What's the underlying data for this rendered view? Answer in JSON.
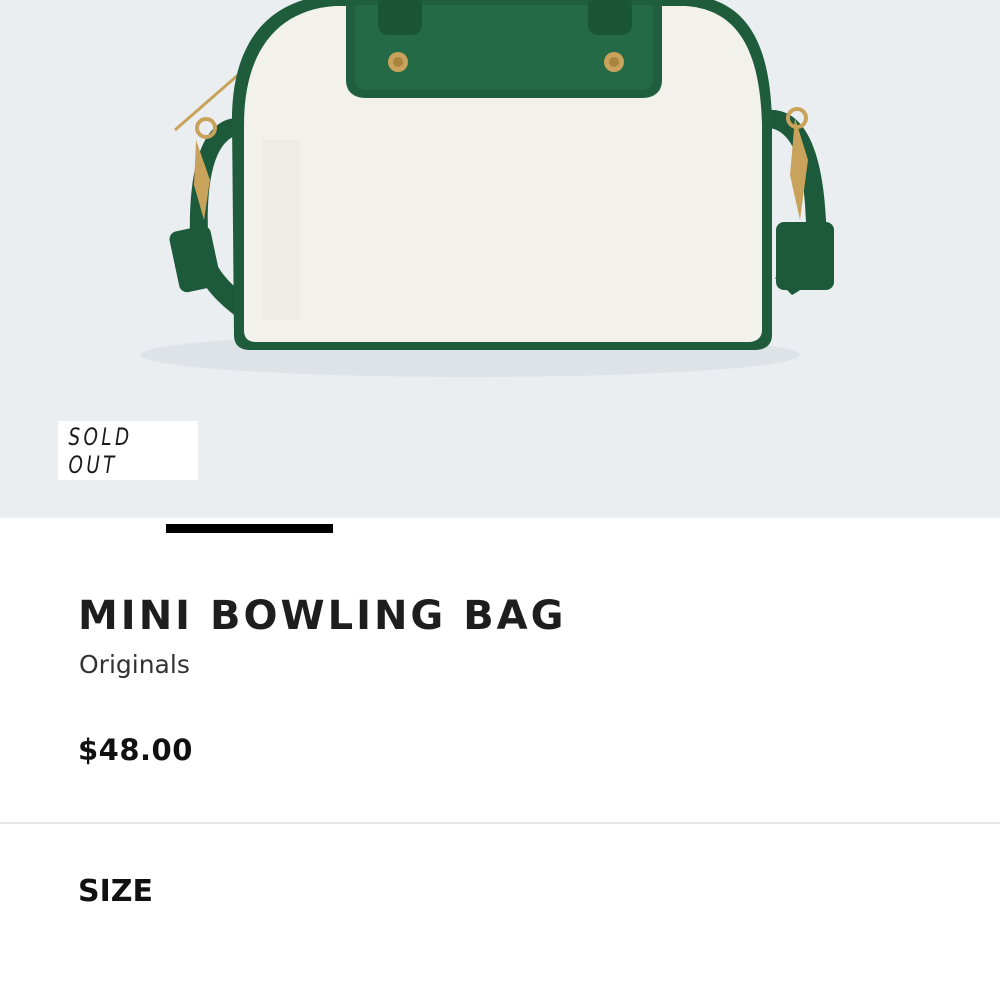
{
  "product": {
    "badge": "SOLD OUT",
    "name": "MINI BOWLING BAG",
    "category": "Originals",
    "price": "$48.00",
    "image_alt": "white and green bowling bag product photo"
  },
  "sections": {
    "size_heading": "SIZE"
  },
  "carousel": {
    "active_index": 2,
    "total": 6
  },
  "colors": {
    "background": "#eaeef1",
    "bag_body": "#f2f1ec",
    "bag_trim": "#1e5c3c",
    "hardware": "#c9a35b",
    "indicator": "#000000"
  }
}
